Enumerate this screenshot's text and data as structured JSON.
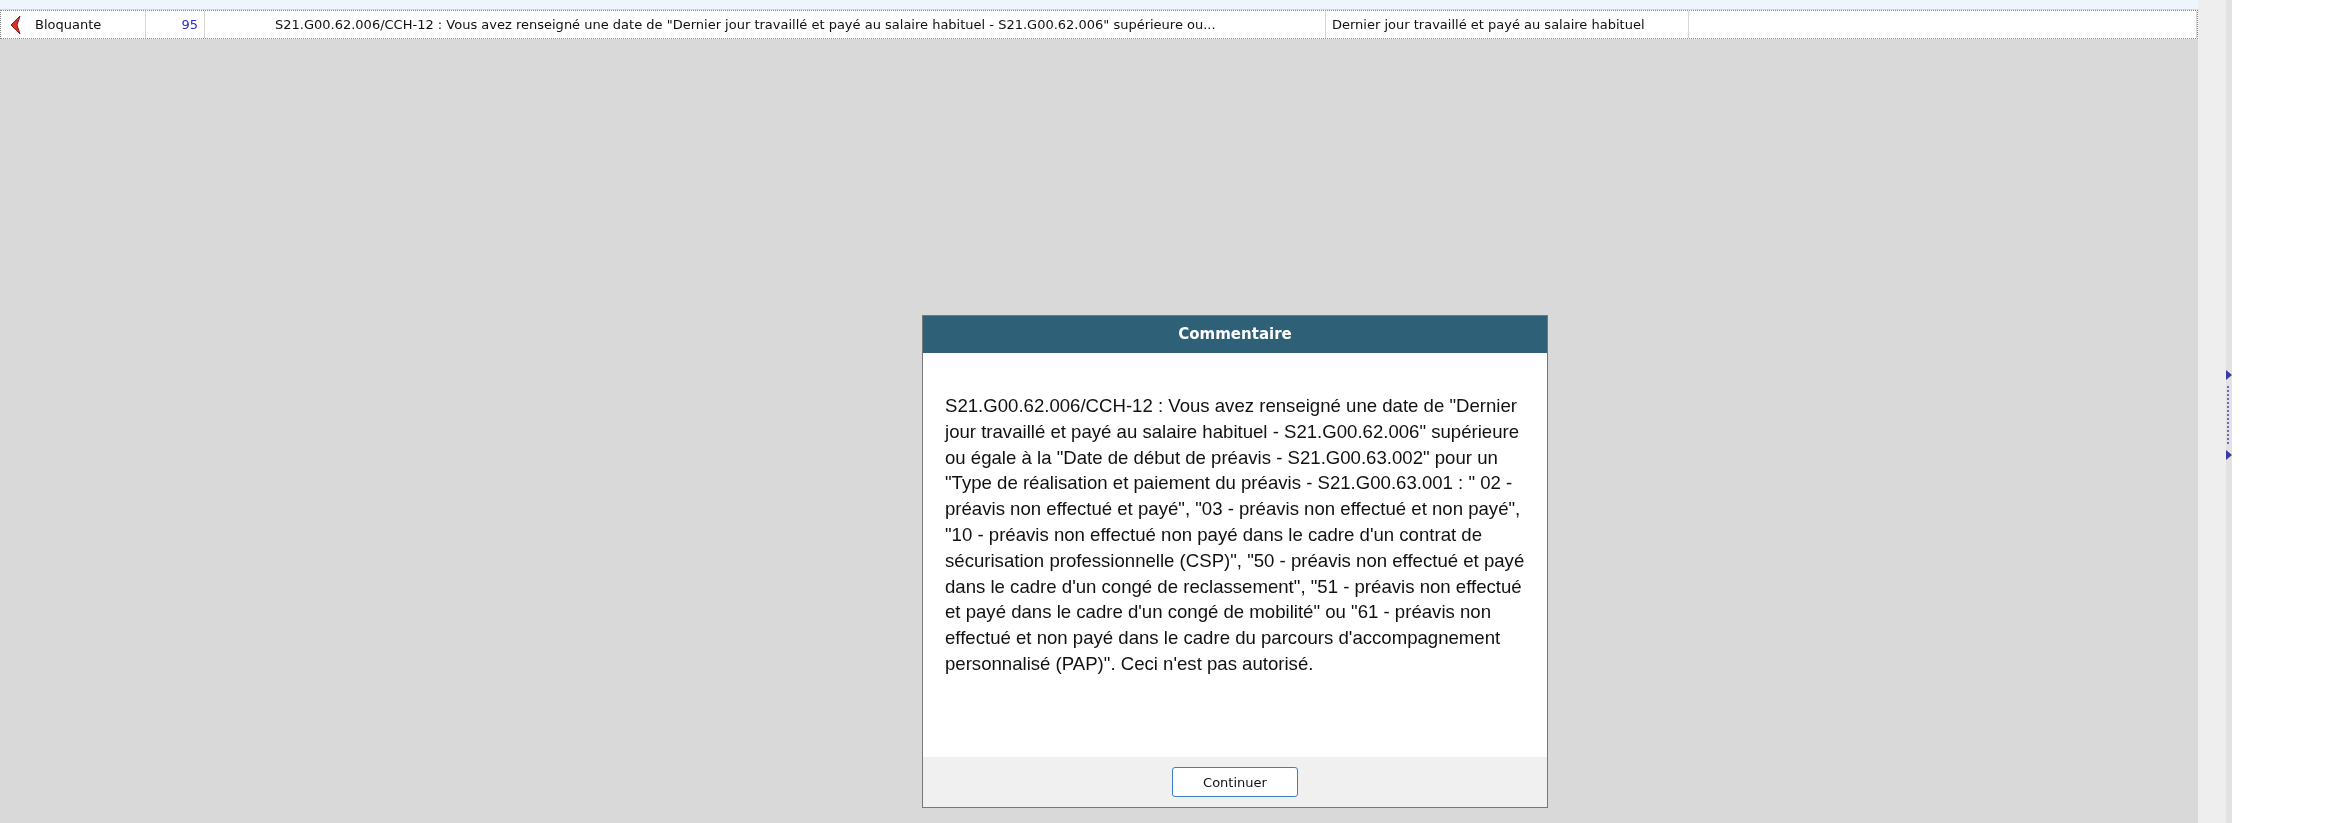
{
  "table": {
    "rows": [
      {
        "severity": "Bloquante",
        "number": "95",
        "message": "S21.G00.62.006/CCH-12 : Vous avez renseigné une date de \"Dernier jour travaillé et payé au salaire habituel - S21.G00.62.006\" supérieure ou...",
        "field": "Dernier jour travaillé et payé au salaire habituel"
      }
    ]
  },
  "dialog": {
    "title": "Commentaire",
    "message": "S21.G00.62.006/CCH-12 : Vous avez renseigné une date de \"Dernier jour travaillé et payé au salaire habituel - S21.G00.62.006\" supérieure ou égale à la \"Date de début de préavis - S21.G00.63.002\" pour un \"Type de réalisation et paiement du préavis - S21.G00.63.001 : \" 02 - préavis non effectué et payé\", \"03 - préavis non effectué et non payé\", \"10 - préavis non effectué non payé dans le cadre d'un contrat de sécurisation professionnelle (CSP)\", \"50 - préavis non effectué et payé dans le cadre d'un congé de reclassement\", \"51 - préavis non effectué et payé dans le cadre d'un congé de mobilité\" ou \"61 - préavis non effectué et non payé dans le cadre du parcours d'accompagnement personnalisé (PAP)\". Ceci n'est pas autorisé.",
    "button": "Continuer"
  }
}
